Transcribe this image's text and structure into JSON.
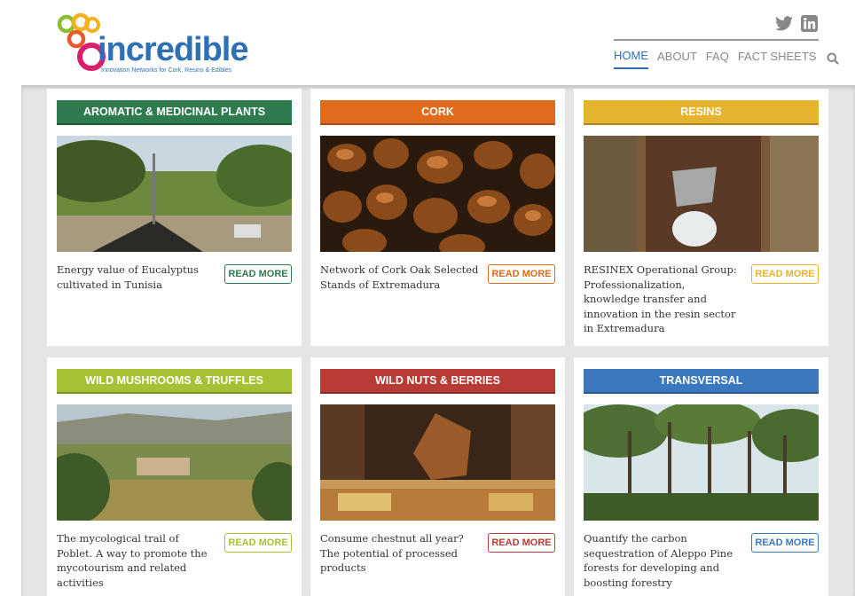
{
  "header": {
    "logo_word": "incredible",
    "logo_tagline": "Innovation Networks for Cork, Resins & Edibles",
    "social": [
      "twitter-icon",
      "linkedin-icon"
    ],
    "nav": [
      {
        "label": "HOME",
        "active": true
      },
      {
        "label": "ABOUT",
        "active": false
      },
      {
        "label": "FAQ",
        "active": false
      },
      {
        "label": "FACT SHEETS",
        "active": false
      }
    ]
  },
  "colors": {
    "brand_blue": "#2f6fb5",
    "aromatic": "#2d7b4f",
    "cork": "#e06b1c",
    "resins": "#e5b32e",
    "mushrooms": "#a4c233",
    "nuts": "#b93b36",
    "transversal": "#3b78bd"
  },
  "cards": [
    {
      "category": "AROMATIC & MEDICINAL PLANTS",
      "title": "Energy value of Eucalyptus cultivated in Tunisia",
      "button": "READ MORE"
    },
    {
      "category": "CORK",
      "title": "Network of Cork Oak Selected Stands of Extremadura",
      "button": "READ MORE"
    },
    {
      "category": "RESINS",
      "title": "RESINEX Operational Group: Professionalization, knowledge transfer and innovation in the resin sector in Extremadura",
      "button": "READ MORE"
    },
    {
      "category": "WILD MUSHROOMS & TRUFFLES",
      "title": "The mycological trail of Poblet. A way to promote the mycotourism and related activities",
      "button": "READ MORE"
    },
    {
      "category": "WILD NUTS & BERRIES",
      "title": "Consume chestnut all year? The potential of processed products",
      "button": "READ MORE"
    },
    {
      "category": "TRANSVERSAL",
      "title": "Quantify the carbon sequestration of Aleppo Pine forests for developing and boosting forestry",
      "button": "READ MORE"
    }
  ]
}
